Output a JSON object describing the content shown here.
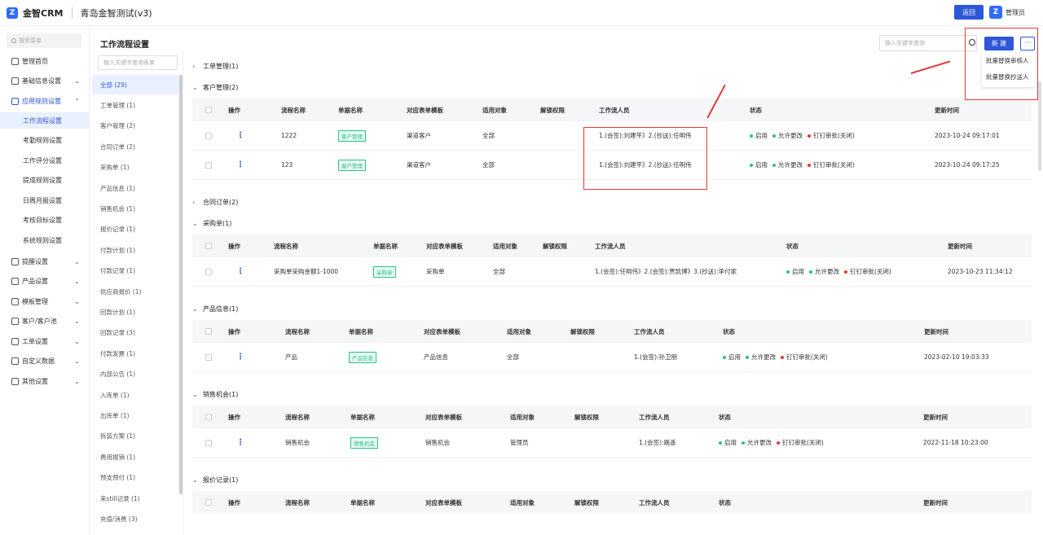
{
  "topbar": {
    "brand": "金智CRM",
    "tenant": "青岛金智测试(v3)",
    "back_label": "返回",
    "admin_name": "管理员"
  },
  "sidebar": {
    "search_placeholder": "搜索菜单",
    "menu": [
      {
        "label": "管理首页",
        "icon": "home-icon",
        "chev": ""
      },
      {
        "label": "基础信息设置",
        "icon": "box-icon",
        "chev": "⌄"
      },
      {
        "label": "应用规则设置",
        "icon": "doc-icon",
        "chev": "⌃",
        "open": true
      }
    ],
    "submenu": [
      "工作流程设置",
      "考勤规则设置",
      "工作评分设置",
      "提成规则设置",
      "日周月报设置",
      "考核目标设置",
      "系统规则设置"
    ],
    "menu_rest": [
      {
        "label": "提醒设置",
        "icon": "bell-icon"
      },
      {
        "label": "产品设置",
        "icon": "product-icon"
      },
      {
        "label": "模板管理",
        "icon": "template-icon"
      },
      {
        "label": "客户/客户池",
        "icon": "customer-icon"
      },
      {
        "label": "工单设置",
        "icon": "ticket-icon"
      },
      {
        "label": "自定义数据",
        "icon": "data-icon"
      },
      {
        "label": "其他设置",
        "icon": "grid-icon"
      }
    ]
  },
  "page_title": "工作流程设置",
  "category_panel": {
    "search_placeholder": "输入关键字查询表单",
    "items": [
      "全部 (29)",
      "工单管理 (1)",
      "客户管理 (2)",
      "合同订单 (2)",
      "采购单 (1)",
      "产品信息 (1)",
      "销售机会 (1)",
      "报价记录 (1)",
      "付款计划 (1)",
      "付款记录 (1)",
      "供应商报价 (1)",
      "回款计划 (1)",
      "回款记录 (3)",
      "付款发票 (1)",
      "内部公告 (1)",
      "入库单 (1)",
      "出库单 (1)",
      "拆装方案 (1)",
      "费用报销 (1)",
      "预支预付 (1)",
      "来still记录 (1)",
      "充值/消费 (3)"
    ]
  },
  "main": {
    "search_placeholder": "输入关键字查询",
    "new_label": "新 建",
    "more_label": "···",
    "dropdown": [
      "批量替换审核人",
      "批量替换抄送人"
    ]
  },
  "headers": {
    "op": "操作",
    "name": "流程名称",
    "form": "单据名称",
    "tpl": "对应表单模板",
    "target": "适用对象",
    "unlock": "解锁权限",
    "staff": "工作流人员",
    "status": "状态",
    "updated": "更新时间"
  },
  "status": {
    "on": "启用",
    "allow": "允许更改",
    "ding": "钉钉审批(关闭)"
  },
  "sections": [
    {
      "title": "工单管理(1)",
      "tri": "›"
    },
    {
      "title": "客户管理(2)",
      "tri": "⌄",
      "rows": [
        {
          "name": "1222",
          "form": "客户管理",
          "tpl": "渠道客户",
          "target": "全部",
          "staff": "1.(会签):刘建平》2.(抄送):任明伟",
          "updated": "2023-10-24 09:17:01"
        },
        {
          "name": "123",
          "form": "客户管理",
          "tpl": "渠道客户",
          "target": "全部",
          "staff": "1.(会签):刘建平》2.(抄送):任明伟",
          "updated": "2023-10-24 09:17:25"
        }
      ]
    },
    {
      "title": "合同订单(2)",
      "tri": "›"
    },
    {
      "title": "采购单(1)",
      "tri": "⌄",
      "rows": [
        {
          "name": "采购单采购金额1-1000",
          "form": "采购单",
          "tpl": "采购单",
          "target": "全部",
          "staff": "1.(会签):任明伟》2.(会签):贾凯博》3.(抄送):李付家",
          "updated": "2023-10-23 11:34:12"
        }
      ]
    },
    {
      "title": "产品信息(1)",
      "tri": "⌄",
      "rows": [
        {
          "name": "产品",
          "form": "产品信息",
          "tpl": "产品信息",
          "target": "全部",
          "staff": "1.(会签):孙卫朋",
          "updated": "2023-02-10 19:03:33"
        }
      ]
    },
    {
      "title": "销售机会(1)",
      "tri": "⌄",
      "rows": [
        {
          "name": "销售机会",
          "form": "销售机会",
          "tpl": "销售机会",
          "target": "管理员",
          "staff": "1.(会签):路遥",
          "updated": "2022-11-18 10:23:00"
        }
      ]
    },
    {
      "title": "报价记录(1)",
      "tri": "⌄"
    }
  ],
  "colors": {
    "accent": "#2f56d6",
    "tag_green": "#28c08f",
    "alert_red": "#e53935"
  }
}
